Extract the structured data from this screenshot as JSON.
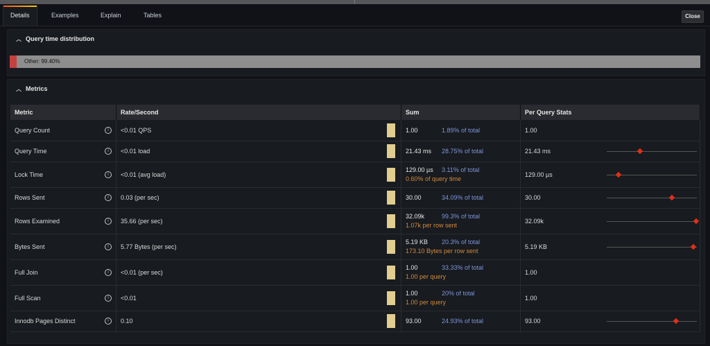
{
  "tabs": [
    {
      "label": "Details",
      "active": true
    },
    {
      "label": "Examples"
    },
    {
      "label": "Explain"
    },
    {
      "label": "Tables"
    }
  ],
  "close_label": "Close",
  "distribution": {
    "title": "Query time distribution",
    "bar_label": "Other: 99.40%",
    "other_fraction": 0.994
  },
  "metrics": {
    "title": "Metrics",
    "headers": [
      "Metric",
      "Rate/Second",
      "Sum",
      "Per Query Stats"
    ],
    "rows": [
      {
        "metric": "Query Count",
        "rate": "<0.01 QPS",
        "sum": "1.00",
        "pct": "1.89% of total",
        "sub": "",
        "per_query": "1.00",
        "spark": null
      },
      {
        "metric": "Query Time",
        "rate": "<0.01 load",
        "sum": "21.43 ms",
        "pct": "28.75% of total",
        "sub": "",
        "per_query": "21.43 ms",
        "spark": 0.37
      },
      {
        "metric": "Lock Time",
        "rate": "<0.01 (avg load)",
        "sum": "129.00 µs",
        "pct": "3.11% of total",
        "sub": "0.60% of query time",
        "per_query": "129.00 µs",
        "spark": 0.13
      },
      {
        "metric": "Rows Sent",
        "rate": "0.03 (per sec)",
        "sum": "30.00",
        "pct": "34.09% of total",
        "sub": "",
        "per_query": "30.00",
        "spark": 0.72
      },
      {
        "metric": "Rows Examined",
        "rate": "35.66 (per sec)",
        "sum": "32.09k",
        "pct": "99.3% of total",
        "sub": "1.07k per row sent",
        "per_query": "32.09k",
        "spark": 0.99
      },
      {
        "metric": "Bytes Sent",
        "rate": "5.77 Bytes (per sec)",
        "sum": "5.19 KB",
        "pct": "20.3% of total",
        "sub": "173.10 Bytes per row sent",
        "per_query": "5.19 KB",
        "spark": 0.96
      },
      {
        "metric": "Full Join",
        "rate": "<0.01 (per sec)",
        "sum": "1.00",
        "pct": "33.33% of total",
        "sub": "1.00 per query",
        "per_query": "1.00",
        "spark": null
      },
      {
        "metric": "Full Scan",
        "rate": "<0.01",
        "sum": "1.00",
        "pct": "20% of total",
        "sub": "1.00 per query",
        "per_query": "1.00",
        "spark": null
      },
      {
        "metric": "Innodb Pages Distinct",
        "rate": "0.10",
        "sum": "93.00",
        "pct": "24.93% of total",
        "sub": "",
        "per_query": "93.00",
        "spark": 0.77
      }
    ]
  },
  "colors": {
    "accent": "#f05a28",
    "pct": "#7e96dc",
    "sub": "#d38a3e",
    "spark_dot": "#e02f1a",
    "mini_bar": "#e0cd8f"
  }
}
